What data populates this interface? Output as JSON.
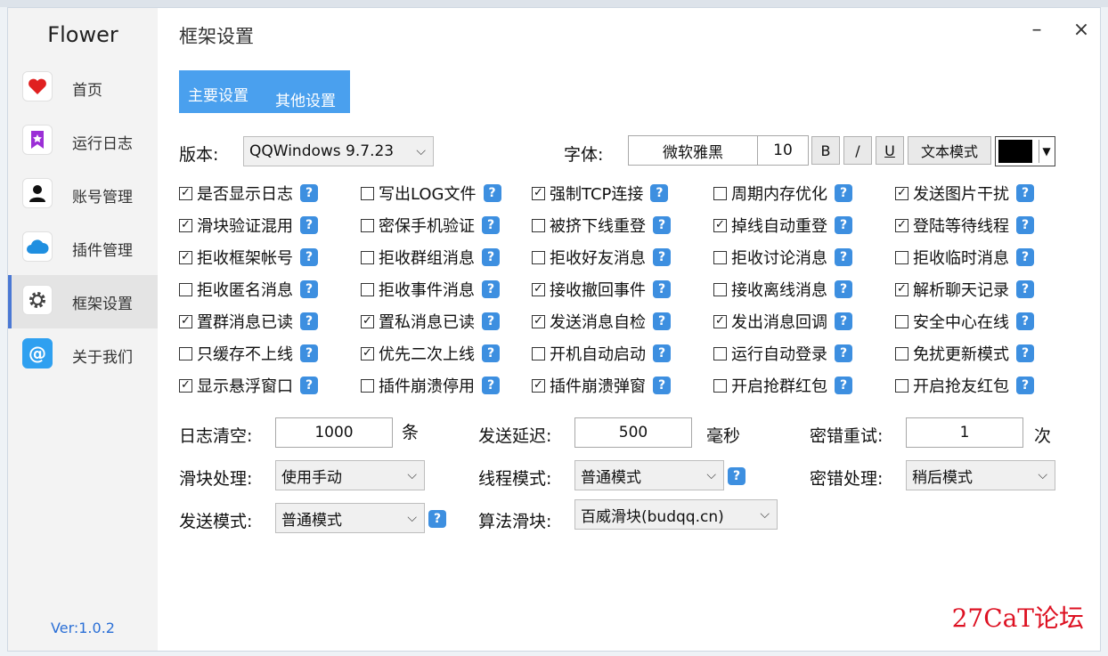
{
  "app": {
    "name": "Flower",
    "version": "Ver:1.0.2"
  },
  "sidebar": {
    "items": [
      {
        "label": "首页",
        "icon": "heart-icon"
      },
      {
        "label": "运行日志",
        "icon": "bookmark-icon"
      },
      {
        "label": "账号管理",
        "icon": "user-icon"
      },
      {
        "label": "插件管理",
        "icon": "cloud-icon"
      },
      {
        "label": "框架设置",
        "icon": "gear-icon",
        "active": true
      },
      {
        "label": "关于我们",
        "icon": "at-icon"
      }
    ]
  },
  "window": {
    "title": "框架设置",
    "minimize": "–",
    "close": "×"
  },
  "tabs": [
    {
      "label": "主要设置"
    },
    {
      "label": "其他设置"
    }
  ],
  "version_row": {
    "label": "版本:",
    "value": "QQWindows 9.7.23"
  },
  "font_row": {
    "label": "字体:",
    "name": "微软雅黑",
    "size": "10",
    "bold": "B",
    "italic": "/",
    "underline": "U",
    "mode_button": "文本模式",
    "color": "#000000"
  },
  "checkbox_rows": [
    [
      {
        "label": "是否显示日志",
        "checked": true
      },
      {
        "label": "写出LOG文件",
        "checked": false
      },
      {
        "label": "强制TCP连接",
        "checked": true
      },
      {
        "label": "周期内存优化",
        "checked": false
      },
      {
        "label": "发送图片干扰",
        "checked": true
      }
    ],
    [
      {
        "label": "滑块验证混用",
        "checked": true
      },
      {
        "label": "密保手机验证",
        "checked": false
      },
      {
        "label": "被挤下线重登",
        "checked": false
      },
      {
        "label": "掉线自动重登",
        "checked": true
      },
      {
        "label": "登陆等待线程",
        "checked": true
      }
    ],
    [
      {
        "label": "拒收框架帐号",
        "checked": true
      },
      {
        "label": "拒收群组消息",
        "checked": false
      },
      {
        "label": "拒收好友消息",
        "checked": false
      },
      {
        "label": "拒收讨论消息",
        "checked": false
      },
      {
        "label": "拒收临时消息",
        "checked": false
      }
    ],
    [
      {
        "label": "拒收匿名消息",
        "checked": false
      },
      {
        "label": "拒收事件消息",
        "checked": false
      },
      {
        "label": "接收撤回事件",
        "checked": true
      },
      {
        "label": "接收离线消息",
        "checked": false
      },
      {
        "label": "解析聊天记录",
        "checked": true
      }
    ],
    [
      {
        "label": "置群消息已读",
        "checked": true
      },
      {
        "label": "置私消息已读",
        "checked": true
      },
      {
        "label": "发送消息自检",
        "checked": true
      },
      {
        "label": "发出消息回调",
        "checked": true
      },
      {
        "label": "安全中心在线",
        "checked": false
      }
    ],
    [
      {
        "label": "只缓存不上线",
        "checked": false
      },
      {
        "label": "优先二次上线",
        "checked": true
      },
      {
        "label": "开机自动启动",
        "checked": false
      },
      {
        "label": "运行自动登录",
        "checked": false
      },
      {
        "label": "免扰更新模式",
        "checked": false
      }
    ],
    [
      {
        "label": "显示悬浮窗口",
        "checked": true
      },
      {
        "label": "插件崩溃停用",
        "checked": false
      },
      {
        "label": "插件崩溃弹窗",
        "checked": true
      },
      {
        "label": "开启抢群红包",
        "checked": false
      },
      {
        "label": "开启抢友红包",
        "checked": false
      }
    ]
  ],
  "fields": {
    "log_clear": {
      "label": "日志清空:",
      "value": "1000",
      "unit": "条"
    },
    "send_delay": {
      "label": "发送延迟:",
      "value": "500",
      "unit": "毫秒"
    },
    "pwd_retry": {
      "label": "密错重试:",
      "value": "1",
      "unit": "次"
    },
    "slider_handle": {
      "label": "滑块处理:",
      "value": "使用手动"
    },
    "thread_mode": {
      "label": "线程模式:",
      "value": "普通模式"
    },
    "pwd_handle": {
      "label": "密错处理:",
      "value": "稍后模式"
    },
    "send_mode": {
      "label": "发送模式:",
      "value": "普通模式"
    },
    "algo_slider": {
      "label": "算法滑块:",
      "value": "百威滑块(budqq.cn)"
    }
  },
  "help_glyph": "?",
  "check_glyph": "✓",
  "watermark": "27CaT论坛",
  "colors": {
    "accent": "#4aa0ee",
    "active_bar": "#4a78d4",
    "help": "#3d8fe0",
    "version": "#2a6fd6"
  }
}
